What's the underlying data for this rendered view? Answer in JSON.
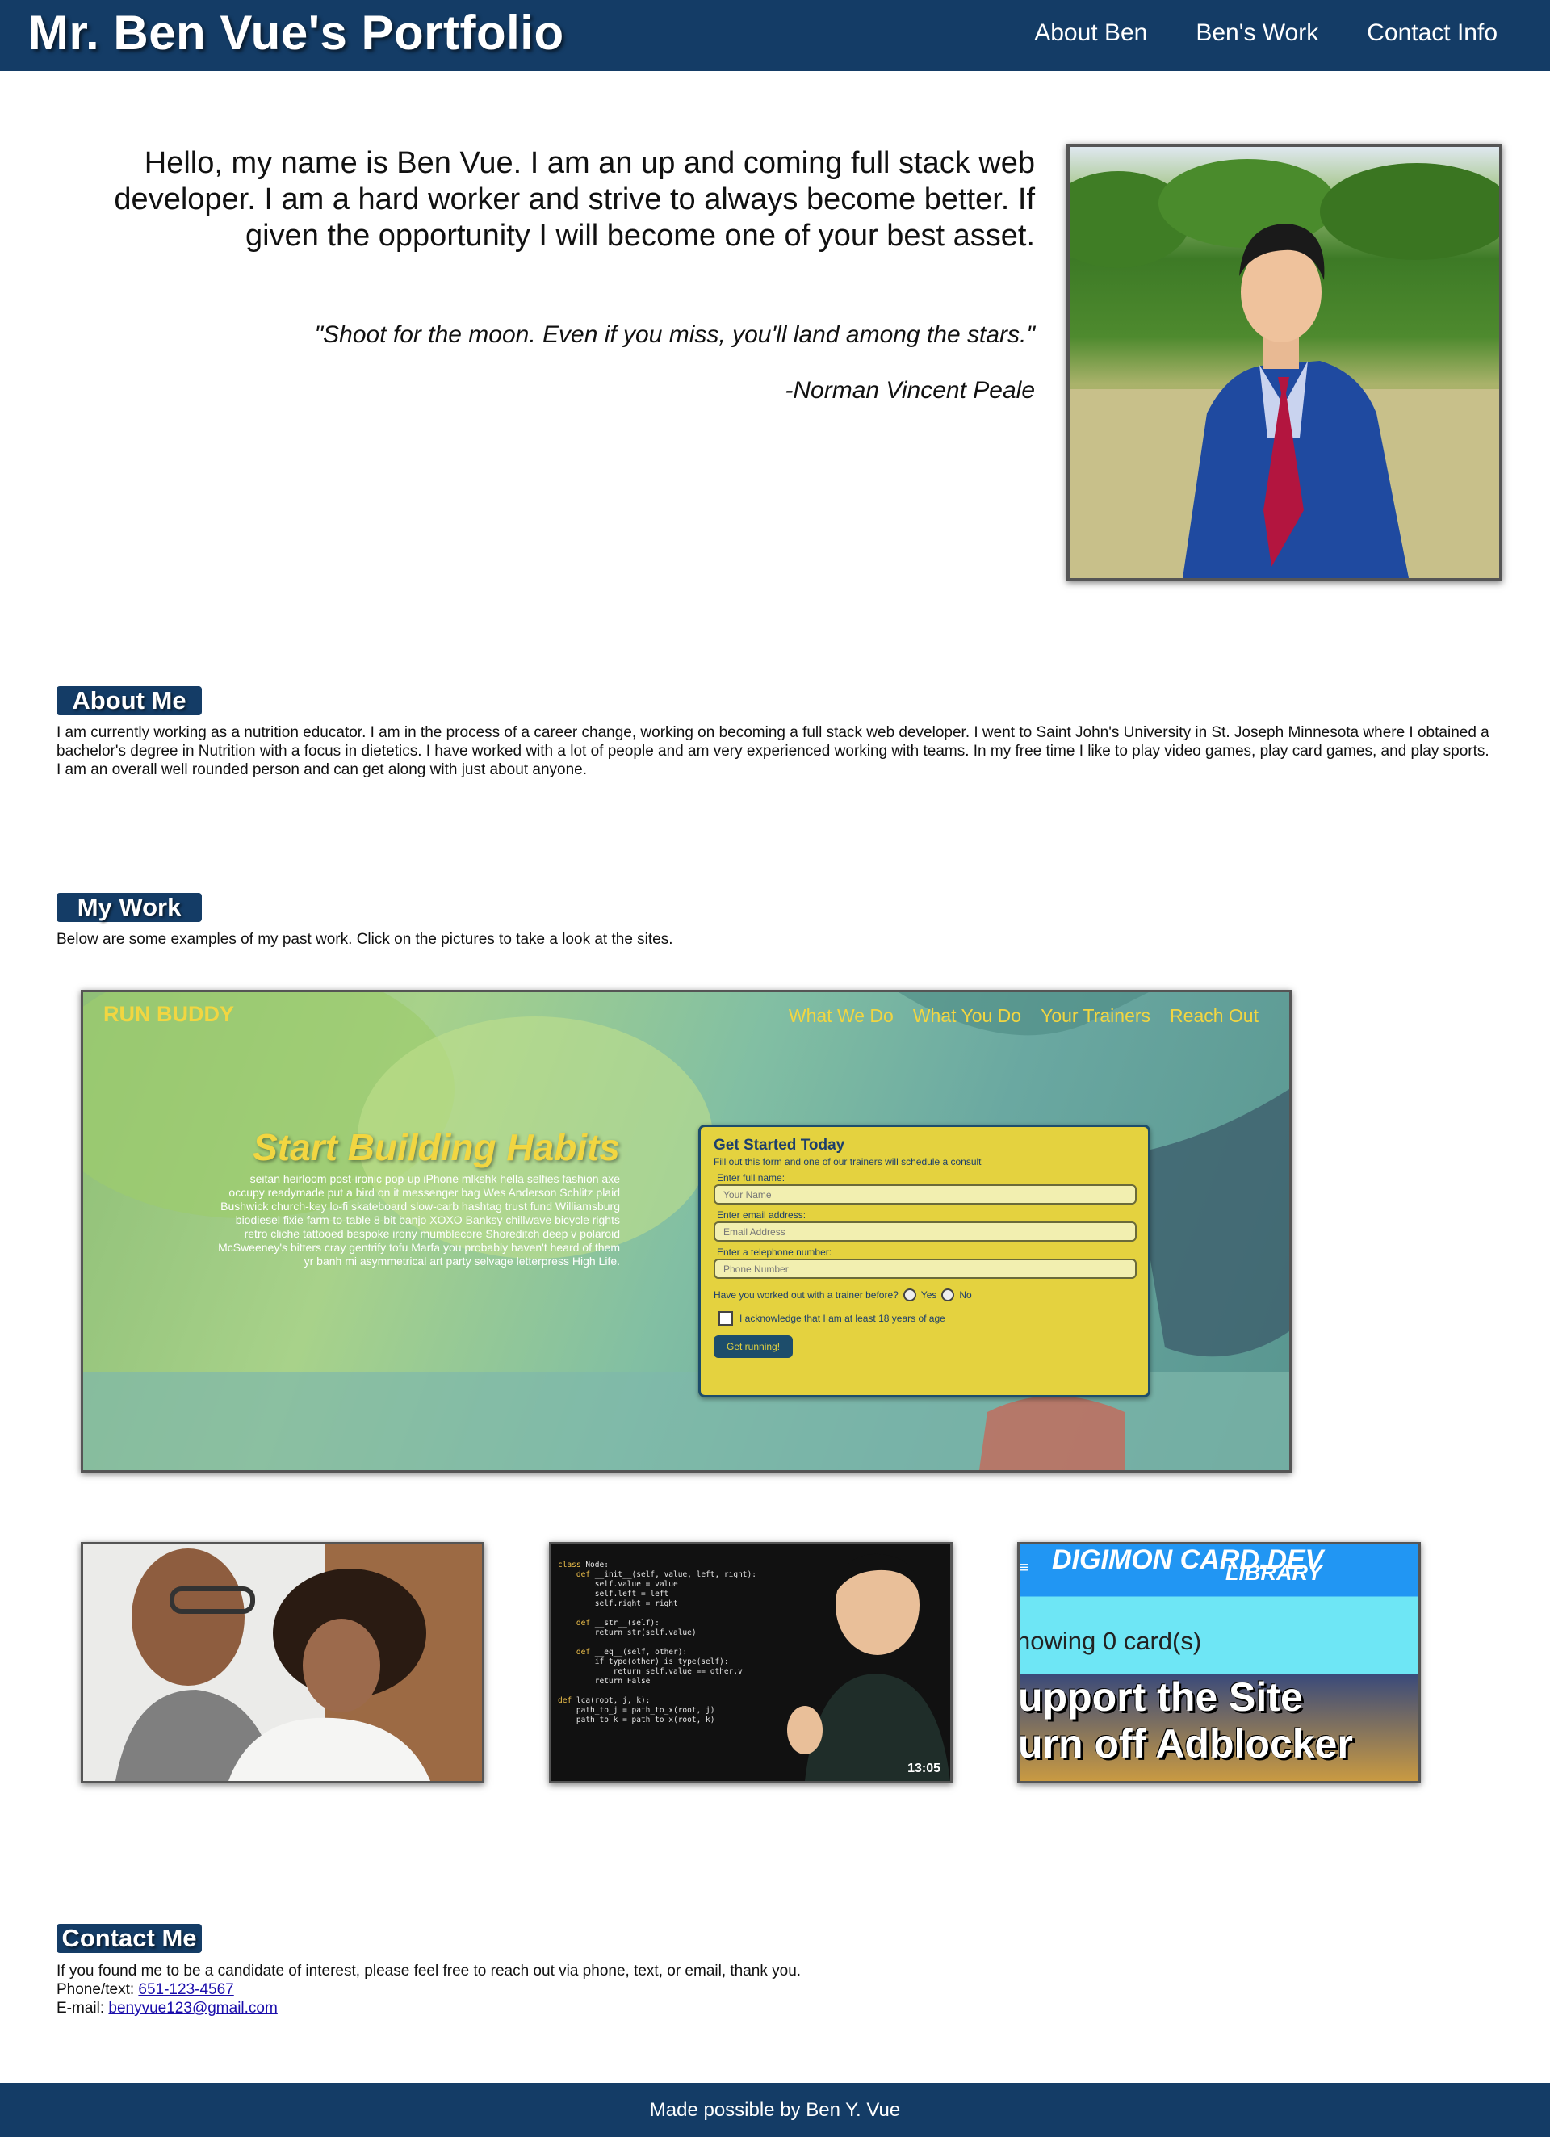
{
  "header": {
    "title": "Mr. Ben Vue's Portfolio",
    "nav": [
      "About Ben",
      "Ben's Work",
      "Contact Info"
    ]
  },
  "intro": {
    "text": "Hello, my name is Ben Vue. I am an up and coming full stack web developer. I am a hard worker and strive to always become better. If given the opportunity I will become one of your best asset.",
    "quote": "\"Shoot for the moon. Even if you miss, you'll land among the stars.\"",
    "quote_author": "-Norman Vincent Peale"
  },
  "about": {
    "heading": "About Me",
    "text": "I am currently working as a nutrition educator. I am in the process of a career change, working on becoming a full stack web developer. I went to Saint John's University in St. Joseph Minnesota where I obtained a bachelor's degree in Nutrition with a focus in dietetics. I have worked with a lot of people and am very experienced working with teams. In my free time I like to play video games, play card games, and play sports. I am an overall well rounded person and can get along with just about anyone."
  },
  "work": {
    "heading": "My Work",
    "text": "Below are some examples of my past work. Click on the pictures to take a look at the sites.",
    "featured": {
      "logo": "RUN BUDDY",
      "nav": [
        "What We Do",
        "What You Do",
        "Your Trainers",
        "Reach Out"
      ],
      "hero_title": "Start Building Habits",
      "hero_text": "seitan heirloom post-ironic pop-up iPhone mlkshk hella selfies fashion axe occupy readymade put a bird on it messenger bag Wes Anderson Schlitz plaid Bushwick church-key lo-fi skateboard slow-carb hashtag trust fund Williamsburg biodiesel fixie farm-to-table 8-bit banjo XOXO Banksy chillwave bicycle rights retro cliche tattooed bespoke irony mumblecore Shoreditch deep v polaroid McSweeney's bitters cray gentrify tofu Marfa you probably haven't heard of them yr banh mi asymmetrical art party selvage letterpress High Life.",
      "form": {
        "title": "Get Started Today",
        "subtitle": "Fill out this form and one of our trainers will schedule a consult",
        "name_label": "Enter full name:",
        "name_placeholder": "Your Name",
        "email_label": "Enter email address:",
        "email_placeholder": "Email Address",
        "phone_label": "Enter a telephone number:",
        "phone_placeholder": "Phone Number",
        "trainer_question": "Have you worked out with a trainer before?",
        "yes": "Yes",
        "no": "No",
        "acknowledge": "I acknowledge that I am at least 18 years of age",
        "submit": "Get running!"
      }
    },
    "thumbnails": {
      "video_duration": "13:05",
      "digimon_logo": "DIGIMON CARD.DEV",
      "digimon_library": "LIBRARY",
      "digimon_count": "howing 0 card(s)",
      "digimon_banner_1": "upport the Site",
      "digimon_banner_2": "urn off Adblocker"
    }
  },
  "contact": {
    "heading": "Contact Me",
    "text": "If you found me to be a candidate of interest, please feel free to reach out via phone, text, or email, thank you.",
    "phone_label": "Phone/text:",
    "phone": "651-123-4567",
    "email_label": "E-mail:",
    "email": "benyvue123@gmail.com"
  },
  "footer": {
    "text": "Made possible by Ben Y. Vue"
  },
  "colors": {
    "primary": "#143c66",
    "runbuddy_yellow": "#f2d641"
  }
}
